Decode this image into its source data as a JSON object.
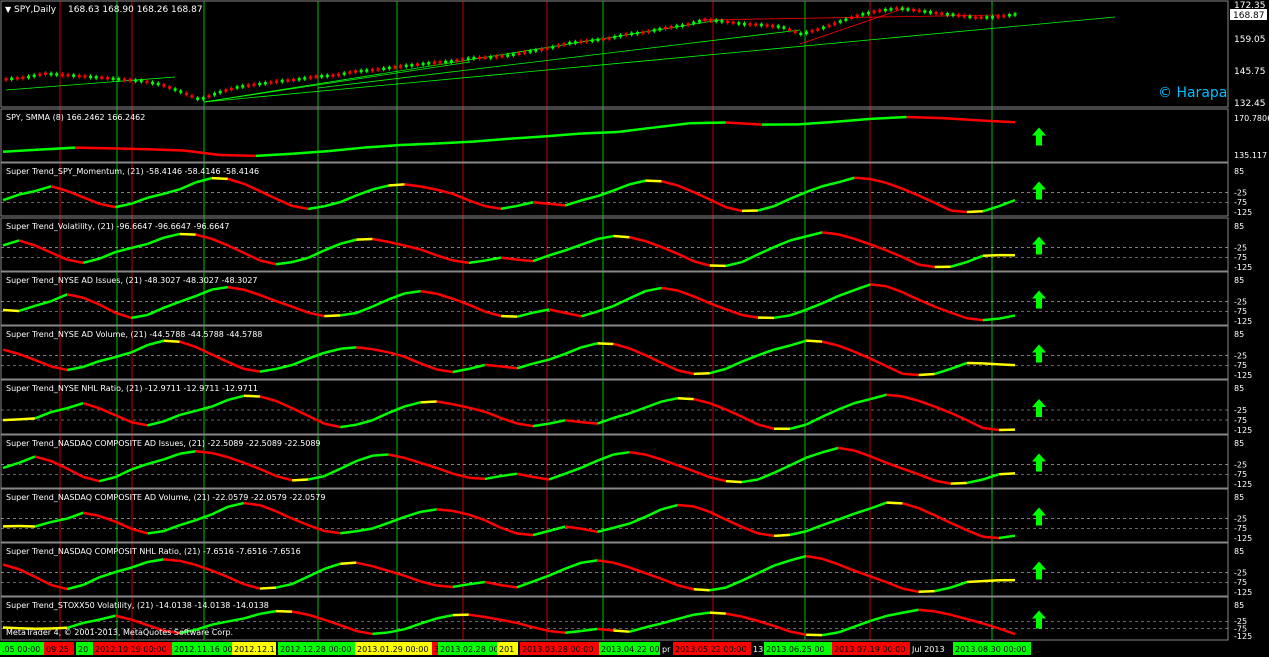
{
  "main_panel": {
    "title": "SPY,Daily",
    "ohlc": "168.63 168.90 168.26 168.87",
    "price_tag": "168.87",
    "y_ticks": [
      "172.35",
      "159.05",
      "145.75",
      "132.45"
    ],
    "watermark": "© Harapa"
  },
  "indicator_panels": [
    {
      "title": "SPY, SMMA (8) 166.2462 166.2462",
      "y_ticks": [
        "170.7806",
        "135.117"
      ]
    },
    {
      "title": "Super Trend_SPY_Momentum, (21)  -58.4146 -58.4146 -58.4146",
      "y_ticks": [
        "85",
        "-25",
        "-75",
        "-125"
      ]
    },
    {
      "title": "Super Trend_Volatility, (21)  -96.6647 -96.6647 -96.6647",
      "y_ticks": [
        "85",
        "-25",
        "-75",
        "-125"
      ]
    },
    {
      "title": "Super Trend_NYSE AD Issues, (21)  -48.3027 -48.3027 -48.3027",
      "y_ticks": [
        "85",
        "-25",
        "-75",
        "-125"
      ]
    },
    {
      "title": "Super Trend_NYSE AD Volume, (21)  -44.5788 -44.5788 -44.5788",
      "y_ticks": [
        "85",
        "-25",
        "-75",
        "-125"
      ]
    },
    {
      "title": "Super Trend_NYSE NHL Ratio, (21)  -12.9711 -12.9711 -12.9711",
      "y_ticks": [
        "85",
        "-25",
        "-75",
        "-125"
      ]
    },
    {
      "title": "Super Trend_NASDAQ COMPOSITE  AD Issues, (21)  -22.5089 -22.5089 -22.5089",
      "y_ticks": [
        "85",
        "-25",
        "-75",
        "-125"
      ]
    },
    {
      "title": "Super Trend_NASDAQ COMPOSITE AD Volume, (21)  -22.0579 -22.0579 -22.0579",
      "y_ticks": [
        "85",
        "-25",
        "-75",
        "-125"
      ]
    },
    {
      "title": "Super Trend_NASDAQ COMPOSIT NHL Ratio, (21)  -7.6516 -7.6516 -7.6516",
      "y_ticks": [
        "85",
        "-25",
        "-75",
        "-125"
      ]
    },
    {
      "title": "Super Trend_STOXX50 Volatility, (21)  -14.0138 -14.0138 -14.0138",
      "y_ticks": [
        "85",
        "-25",
        "-75",
        "-125"
      ]
    }
  ],
  "copyright": "MetaQuotes Software Corp.",
  "copyright_full": "MetaTrader 4, © 2001-2013, MetaQuotes Software Corp.",
  "date_labels": [
    {
      "text": ".05 00:00",
      "bg": "#00ff00"
    },
    {
      "text": "09.25",
      "bg": "#ff0000"
    },
    {
      "text": "20",
      "bg": "#00ff00"
    },
    {
      "text": "2012.10.19 00:00",
      "bg": "#ff0000"
    },
    {
      "text": "2012.11.16 00:00",
      "bg": "#00ff00"
    },
    {
      "text": "2012.12.1",
      "bg": "#ffff00"
    },
    {
      "text": "2012.12.28 00:00",
      "bg": "#00ff00"
    },
    {
      "text": "2013.01.29 00:00",
      "bg": "#ffff00"
    },
    {
      "text": "3",
      "bg": "#ff0000"
    },
    {
      "text": "2013.02.28 00",
      "bg": "#00ff00"
    },
    {
      "text": "201",
      "bg": "#ffff00"
    },
    {
      "text": "2013.03.28 00:00",
      "bg": "#ff0000"
    },
    {
      "text": "2013.04.22 00:00",
      "bg": "#00ff00"
    },
    {
      "text": "pr",
      "bg": "#000000"
    },
    {
      "text": "2013.05.22 00:00",
      "bg": "#ff0000"
    },
    {
      "text": "13",
      "bg": "#000000"
    },
    {
      "text": "2013.06.25 00",
      "bg": "#00ff00"
    },
    {
      "text": "2013.07.19 00:00",
      "bg": "#ff0000"
    },
    {
      "text": "Jul 2013",
      "bg": "#000000"
    },
    {
      "text": "2013.08.30 00:00",
      "bg": "#00ff00"
    }
  ],
  "colors": {
    "background": "#000000",
    "up": "#00ff00",
    "down": "#ff0000",
    "neutral": "#ffff00",
    "vline_green": "#00c000",
    "vline_red": "#c00000",
    "text": "#ffffff",
    "watermark": "#00bfff"
  },
  "signal": "up-arrow",
  "chart_data": {
    "type": "line",
    "price_range": [
      132.45,
      172.35
    ],
    "smma_range": [
      135.117,
      170.7806
    ],
    "supertrend_range": [
      -125,
      85
    ],
    "price_series": [
      142.5,
      143.2,
      144.8,
      144.3,
      143.7,
      143.1,
      142.4,
      141.8,
      140.4,
      137.5,
      134.2,
      137.2,
      139.4,
      140.5,
      141.6,
      142.4,
      143.6,
      144.1,
      145.7,
      146.3,
      147.4,
      148.3,
      149.2,
      149.8,
      151.1,
      151.4,
      152.3,
      153.8,
      155.2,
      157.2,
      158.1,
      159.0,
      160.8,
      161.7,
      163.4,
      164.5,
      166.7,
      166.1,
      165.0,
      164.6,
      163.8,
      160.9,
      163.1,
      166.0,
      168.7,
      170.4,
      171.4,
      170.5,
      169.4,
      168.6,
      167.6,
      167.8,
      168.9
    ],
    "smma_series": [
      140.6,
      142.4,
      144.1,
      143.5,
      142.7,
      141.6,
      137.7,
      137.0,
      138.8,
      141.1,
      144.2,
      146.4,
      147.7,
      149.4,
      151.9,
      153.9,
      156.4,
      157.7,
      161.6,
      165.3,
      166.0,
      164.1,
      164.4,
      166.5,
      169.2,
      170.8,
      169.8,
      167.8,
      166.2
    ],
    "supertrend_momentum_series": [
      -58.4,
      -25,
      0,
      35,
      10,
      -30,
      -75,
      -100,
      -80,
      -40,
      -10,
      20,
      60,
      80,
      70,
      40,
      0,
      -40,
      -80,
      -100,
      -90,
      -70,
      -30,
      10,
      40,
      50,
      35,
      10,
      -20,
      -60,
      -90,
      -100,
      -80,
      -60,
      -75,
      -90,
      -60,
      -30,
      10,
      50,
      70,
      60,
      30,
      -10,
      -50,
      -90,
      -110,
      -110,
      -90,
      -50,
      -10,
      30,
      60,
      90,
      80,
      50,
      10,
      -30,
      -70,
      -110,
      -125,
      -115,
      -90,
      -58.4
    ]
  }
}
